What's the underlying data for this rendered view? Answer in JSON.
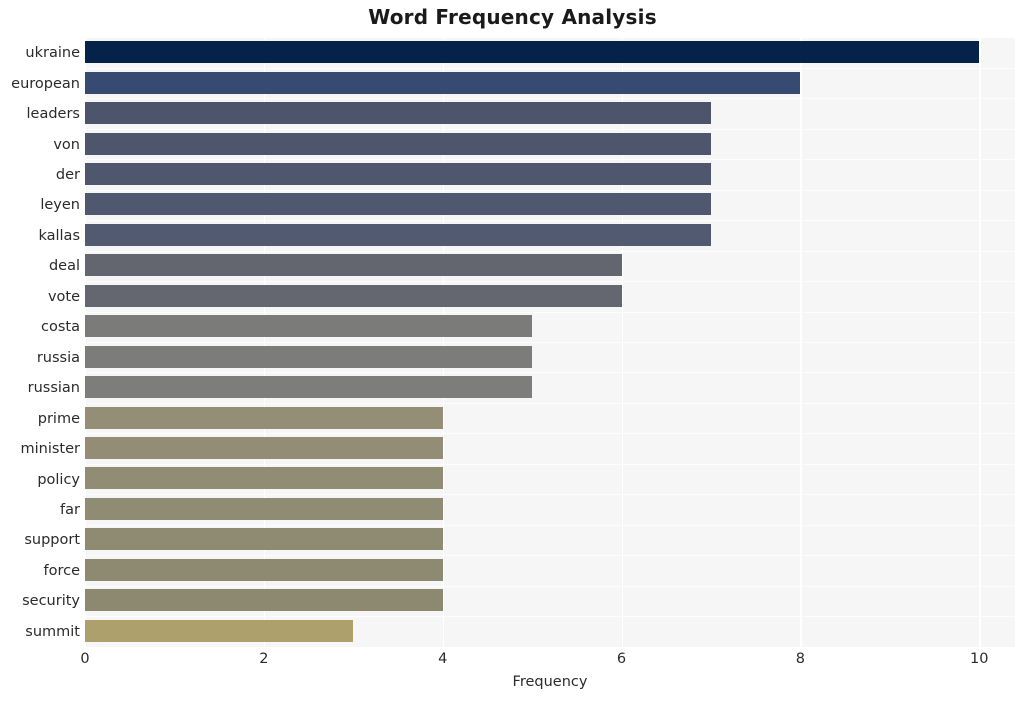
{
  "chart_data": {
    "type": "bar",
    "orientation": "horizontal",
    "title": "Word Frequency Analysis",
    "xlabel": "Frequency",
    "ylabel": "",
    "xlim": [
      0,
      10.4
    ],
    "xticks": [
      0,
      2,
      4,
      6,
      8,
      10
    ],
    "xticklabels": [
      "0",
      "2",
      "4",
      "6",
      "8",
      "10"
    ],
    "grid": true,
    "grid_axis": "both",
    "legend": null,
    "categories": [
      "ukraine",
      "european",
      "leaders",
      "von",
      "der",
      "leyen",
      "kallas",
      "deal",
      "vote",
      "costa",
      "russia",
      "russian",
      "prime",
      "minister",
      "policy",
      "far",
      "support",
      "force",
      "security",
      "summit"
    ],
    "values": [
      10,
      8,
      7,
      7,
      7,
      7,
      7,
      6,
      6,
      5,
      5,
      5,
      4,
      4,
      4,
      4,
      4,
      4,
      4,
      3
    ],
    "bar_colors": [
      "#052349",
      "#374a72",
      "#4c556c",
      "#4e566d",
      "#4f576e",
      "#505870",
      "#525a72",
      "#63656f",
      "#646670",
      "#7b7b7a",
      "#7c7c7a",
      "#7d7d7b",
      "#938e75",
      "#928d74",
      "#918c74",
      "#908b73",
      "#8f8a72",
      "#8e8971",
      "#8d8870",
      "#ada06c"
    ],
    "plot_background": "#f6f6f7",
    "figure_background": "#ffffff",
    "gridline_color": "#ffffff",
    "text_color": "#2b2b2b"
  }
}
